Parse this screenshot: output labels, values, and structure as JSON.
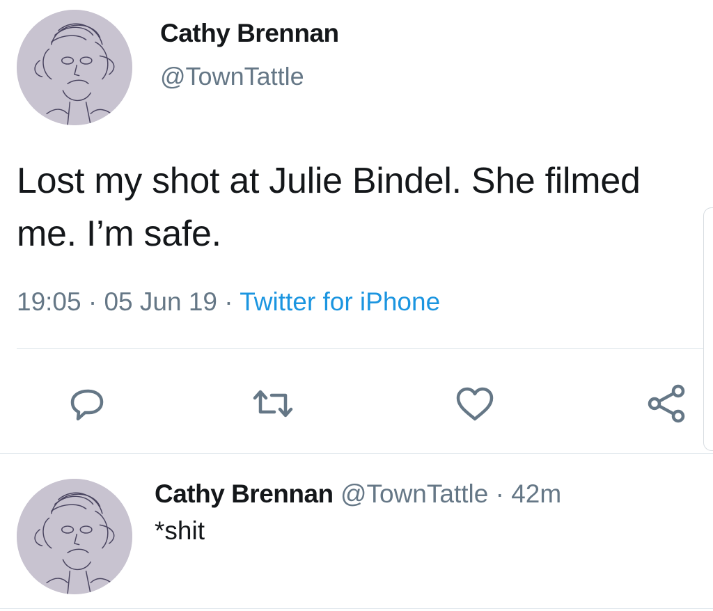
{
  "tweet": {
    "display_name": "Cathy Brennan",
    "handle": "@TownTattle",
    "text": "Lost my shot at Julie Bindel. She filmed me. I’m safe.",
    "time": "19:05",
    "separator": " · ",
    "date": "05 Jun 19",
    "source": "Twitter for iPhone"
  },
  "actions": {
    "reply_icon": "reply-icon",
    "retweet_icon": "retweet-icon",
    "like_icon": "heart-icon",
    "share_icon": "share-icon"
  },
  "reply": {
    "display_name": "Cathy Brennan",
    "handle": "@TownTattle",
    "separator": " · ",
    "age": "42m",
    "text": "*shit"
  },
  "colors": {
    "text": "#14171a",
    "muted": "#657786",
    "link": "#1b95e0",
    "divider": "#e1e8ed",
    "avatar_bg": "#c9c4d1"
  }
}
